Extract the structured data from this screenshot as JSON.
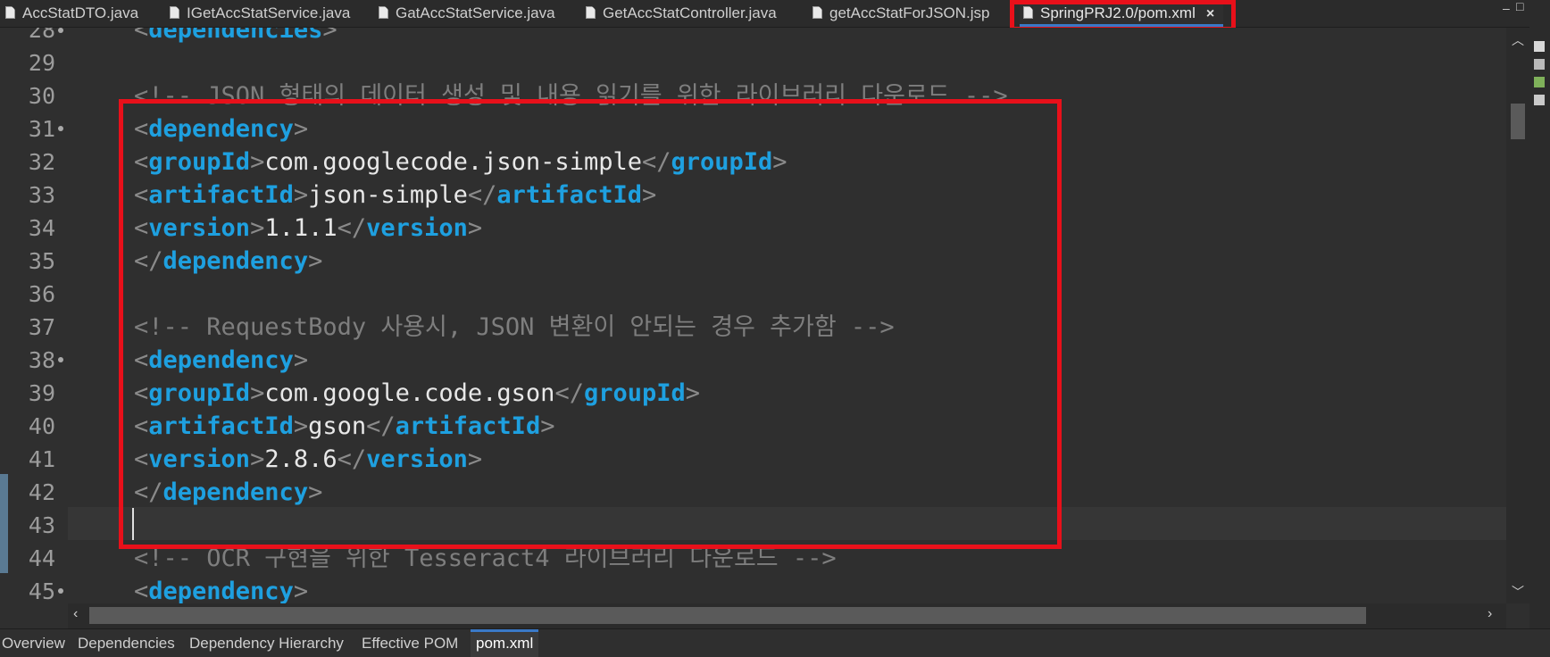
{
  "tabs": [
    {
      "label": "AccStatDTO.java",
      "active": false
    },
    {
      "label": "IGetAccStatService.java",
      "active": false
    },
    {
      "label": "GatAccStatService.java",
      "active": false
    },
    {
      "label": "GetAccStatController.java",
      "active": false
    },
    {
      "label": "getAccStatForJSON.jsp",
      "active": false
    },
    {
      "label": "SpringPRJ2.0/pom.xml",
      "active": true
    }
  ],
  "window_controls": {
    "minimize": "–",
    "maximize": "□"
  },
  "close_glyph": "×",
  "editor": {
    "lines": [
      {
        "num": "28",
        "fold": true
      },
      {
        "num": "29"
      },
      {
        "num": "30"
      },
      {
        "num": "31",
        "fold": true
      },
      {
        "num": "32"
      },
      {
        "num": "33"
      },
      {
        "num": "34"
      },
      {
        "num": "35"
      },
      {
        "num": "36"
      },
      {
        "num": "37"
      },
      {
        "num": "38",
        "fold": true
      },
      {
        "num": "39"
      },
      {
        "num": "40"
      },
      {
        "num": "41"
      },
      {
        "num": "42"
      },
      {
        "num": "43"
      },
      {
        "num": "44"
      },
      {
        "num": "45",
        "fold": true
      }
    ],
    "code": {
      "l28_tag": "dependencies",
      "l30_comment": "<!-- JSON 형태의 데이터 생성 및 내용 읽기를 위한 라이브러리 다운로드 -->",
      "dependency": "dependency",
      "groupId": "groupId",
      "artifactId": "artifactId",
      "version": "version",
      "l32_value": "com.googlecode.json-simple",
      "l33_value": "json-simple",
      "l34_value": "1.1.1",
      "l37_comment": "<!-- RequestBody 사용시, JSON 변환이 안되는 경우 추가함 -->",
      "l39_value": "com.google.code.gson",
      "l40_value": "gson",
      "l41_value": "2.8.6",
      "l44_comment": "<!-- OCR 구현을 위한 Tesseract4 라이브러리 다운로드 -->"
    }
  },
  "scroll": {
    "up": "︿",
    "down": "﹀",
    "left": "‹",
    "right": "›"
  },
  "bottom_tabs": [
    {
      "label": "Overview",
      "active": false
    },
    {
      "label": "Dependencies",
      "active": false
    },
    {
      "label": "Dependency Hierarchy",
      "active": false
    },
    {
      "label": "Effective POM",
      "active": false
    },
    {
      "label": "pom.xml",
      "active": true
    }
  ],
  "colors": {
    "highlight": "#e8101a",
    "tag": "#1ea0e0",
    "comment": "#7e7e7e",
    "accent": "#3a79c7"
  }
}
